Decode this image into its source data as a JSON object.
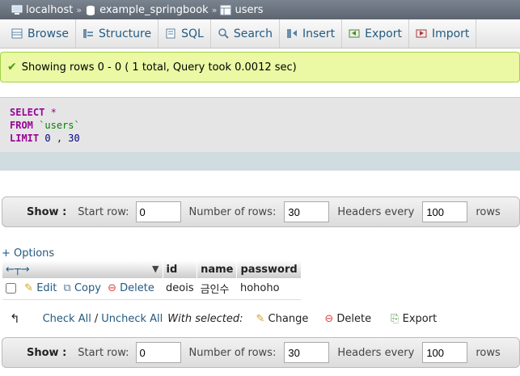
{
  "breadcrumb": {
    "server": "localhost",
    "database": "example_springbook",
    "table": "users"
  },
  "tabs": [
    {
      "label": "Browse",
      "icon": "browse-icon"
    },
    {
      "label": "Structure",
      "icon": "structure-icon"
    },
    {
      "label": "SQL",
      "icon": "sql-icon"
    },
    {
      "label": "Search",
      "icon": "search-icon"
    },
    {
      "label": "Insert",
      "icon": "insert-icon"
    },
    {
      "label": "Export",
      "icon": "export-icon"
    },
    {
      "label": "Import",
      "icon": "import-icon"
    }
  ],
  "message": "Showing rows 0 - 0 ( 1 total, Query took 0.0012 sec)",
  "query": {
    "select": "SELECT",
    "star": "*",
    "from": "FROM",
    "table": "`users`",
    "limit": "LIMIT",
    "offset": "0",
    "comma": ",",
    "count": "30"
  },
  "nav": {
    "show": "Show :",
    "start_row_label": "Start row:",
    "start_row": "0",
    "num_rows_label": "Number of rows:",
    "num_rows": "30",
    "headers_label": "Headers every",
    "headers_every": "100",
    "rows_label": "rows"
  },
  "options_link": "+ Options",
  "columns": [
    "id",
    "name",
    "password"
  ],
  "row": {
    "edit": "Edit",
    "copy": "Copy",
    "delete": "Delete",
    "id": "deois",
    "name": "금인수",
    "password": "hohoho"
  },
  "bulk": {
    "check_all": "Check All",
    "slash": "/",
    "uncheck_all": "Uncheck All",
    "with_selected": "With selected:",
    "change": "Change",
    "delete": "Delete",
    "export": "Export"
  },
  "colors": {
    "link": "#235a81",
    "keyword": "#990099",
    "success_bg": "#ebf8a4"
  }
}
